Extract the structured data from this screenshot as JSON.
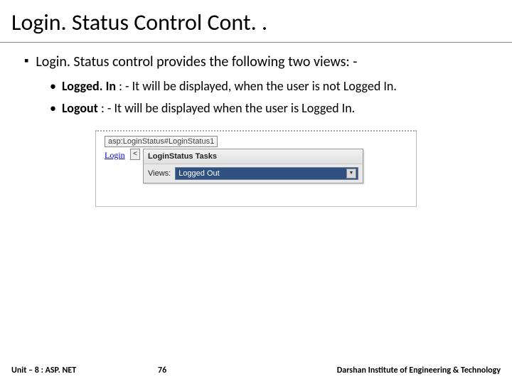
{
  "title": "Login. Status Control Cont. .",
  "bullets": {
    "main": "Login. Status control provides the following two views: -",
    "sub1_bold": "Logged. In",
    "sub1_rest": " : - It will be displayed, when the user is not Logged In.",
    "sub2_bold": "Logout",
    "sub2_rest": " : - It will be displayed when the user is Logged In."
  },
  "figure": {
    "tag": "asp:LoginStatus#LoginStatus1",
    "link": "Login",
    "smart_tag": "<",
    "panel_title": "LoginStatus Tasks",
    "views_label": "Views:",
    "views_value": "Logged Out",
    "arrow": "▼"
  },
  "footer": {
    "left": "Unit – 8 : ASP. NET",
    "page": "76",
    "right": "Darshan Institute of Engineering & Technology"
  }
}
